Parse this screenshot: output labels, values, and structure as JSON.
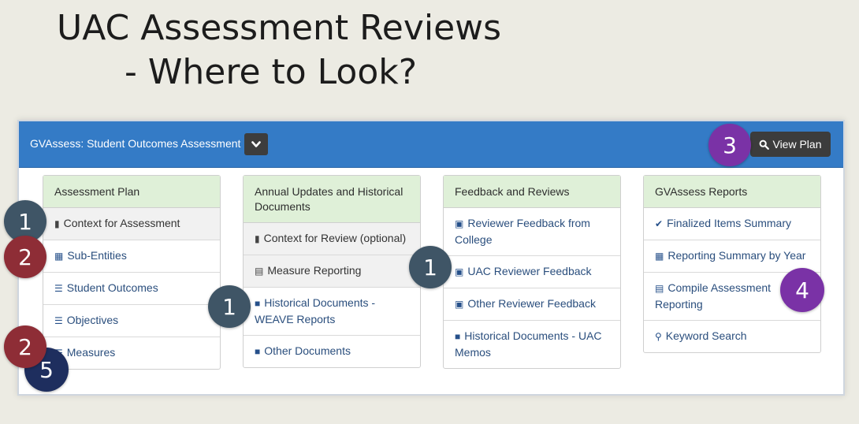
{
  "slide": {
    "title_line1": "UAC Assessment Reviews",
    "title_line2": "- Where to Look?"
  },
  "app": {
    "title": "GVAssess: Student Outcomes Assessment",
    "dropdown_icon": "chevron-down-icon",
    "view_plan_label": "View Plan",
    "view_plan_icon": "search-icon",
    "header_color": "#347bc6"
  },
  "columns": [
    {
      "header": "Assessment Plan",
      "items": [
        {
          "label": "Context for Assessment",
          "icon": "file-icon"
        },
        {
          "label": "Sub-Entities",
          "icon": "grid-icon"
        },
        {
          "label": "Student Outcomes",
          "icon": "list-icon"
        },
        {
          "label": "Objectives",
          "icon": "list-icon"
        },
        {
          "label": "Measures",
          "icon": "list-icon"
        }
      ]
    },
    {
      "header": "Annual Updates and Historical Documents",
      "items": [
        {
          "label": "Context for Review (optional)",
          "icon": "file-icon"
        },
        {
          "label": "Measure Reporting",
          "icon": "table-icon"
        },
        {
          "label": "Historical Documents - WEAVE Reports",
          "icon": "folder-icon"
        },
        {
          "label": "Other Documents",
          "icon": "folder-icon"
        }
      ]
    },
    {
      "header": "Feedback and Reviews",
      "items": [
        {
          "label": "Reviewer Feedback from College",
          "icon": "comment-icon"
        },
        {
          "label": "UAC Reviewer Feedback",
          "icon": "comment-icon"
        },
        {
          "label": "Other Reviewer Feedback",
          "icon": "comment-icon"
        },
        {
          "label": "Historical Documents - UAC Memos",
          "icon": "folder-icon"
        }
      ]
    },
    {
      "header": "GVAssess Reports",
      "items": [
        {
          "label": "Finalized Items Summary",
          "icon": "check-icon"
        },
        {
          "label": "Reporting Summary by Year",
          "icon": "calendar-icon"
        },
        {
          "label": "Compile Assessment Reporting",
          "icon": "table-icon"
        },
        {
          "label": "Keyword Search",
          "icon": "search-icon"
        }
      ]
    }
  ],
  "badges": [
    {
      "number": "1",
      "color": "#3f5566"
    },
    {
      "number": "2",
      "color": "#8e2d36"
    },
    {
      "number": "2",
      "color": "#8e2d36"
    },
    {
      "number": "5",
      "color": "#1e2e5e"
    },
    {
      "number": "1",
      "color": "#3f5566"
    },
    {
      "number": "1",
      "color": "#3f5566"
    },
    {
      "number": "3",
      "color": "#7a32a6"
    },
    {
      "number": "4",
      "color": "#7a32a6"
    }
  ]
}
